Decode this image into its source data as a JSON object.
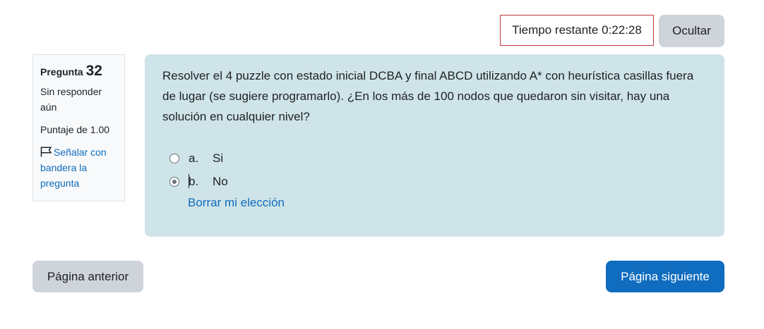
{
  "timer": {
    "label": "Tiempo restante",
    "value": "0:22:28",
    "hide_label": "Ocultar"
  },
  "info": {
    "question_label": "Pregunta",
    "question_number": "32",
    "state": "Sin responder aún",
    "grade": "Puntaje de 1.00",
    "flag_label": "Señalar con bandera la pregunta",
    "flag_icon": "flag-icon"
  },
  "question": {
    "text": "Resolver el 4 puzzle con estado inicial DCBA y final ABCD utilizando A* con heurística casillas fuera de lugar (se sugiere programarlo). ¿En los más de 100 nodos que quedaron sin visitar, hay una solución en cualquier nivel?",
    "answers": [
      {
        "letter": "a.",
        "text": "Si",
        "selected": false
      },
      {
        "letter": "b.",
        "text": "No",
        "selected": true
      }
    ],
    "clear_label": "Borrar mi elección"
  },
  "nav": {
    "prev_label": "Página anterior",
    "next_label": "Página siguiente"
  },
  "colors": {
    "accent": "#0f6cbf",
    "content_bg": "#cfe4e8",
    "timer_border": "#c0393b",
    "secondary_button": "#ced4da"
  }
}
